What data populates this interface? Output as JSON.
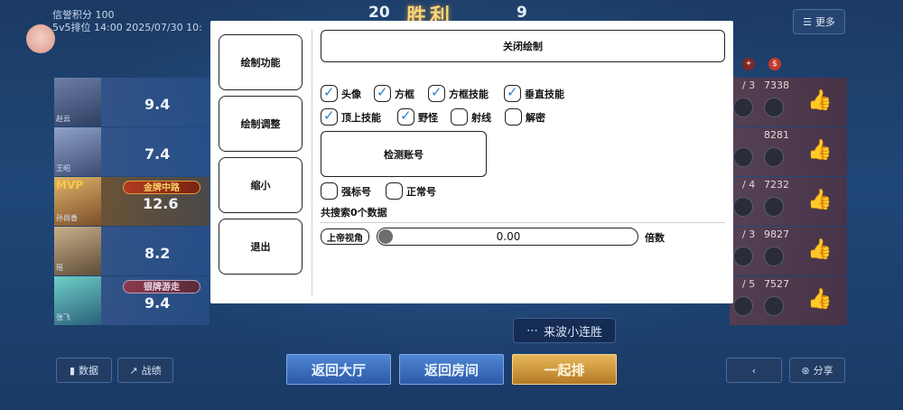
{
  "status": {
    "credit": "信誉积分 100",
    "mode_line": "5v5排位  14:00   2025/07/30 10:"
  },
  "scoreboard": {
    "left_score": "20",
    "result": "胜利",
    "right_score": "9"
  },
  "more_button": "更多",
  "left_players": [
    {
      "name": "赵云",
      "score": "9.4",
      "mvp": "",
      "medal": ""
    },
    {
      "name": "王昭",
      "score": "7.4",
      "mvp": "",
      "medal": ""
    },
    {
      "name": "孙尚香",
      "score": "12.6",
      "mvp": "MVP",
      "medal": "金牌中路"
    },
    {
      "name": "瑶",
      "score": "8.2",
      "mvp": "",
      "medal": ""
    },
    {
      "name": "张飞",
      "score": "9.4",
      "mvp": "",
      "medal": "银牌游走"
    }
  ],
  "right_players": [
    {
      "kda": "/ 3",
      "gold": "7338"
    },
    {
      "kda": "",
      "gold": "8281"
    },
    {
      "kda": "/ 4",
      "gold": "7232"
    },
    {
      "kda": "/ 3",
      "gold": "9827"
    },
    {
      "kda": "/ 5",
      "gold": "7527"
    }
  ],
  "streak": "来波小连胜",
  "bottom": {
    "data_btn": "数据",
    "battle_btn": "战绩",
    "lobby_btn": "返回大厅",
    "room_btn": "返回房间",
    "queue_btn": "一起排",
    "share_btn": "分享",
    "back_icon": "arrow-left-icon"
  },
  "dialog": {
    "side_menu": [
      "绘制功能",
      "绘制调整",
      "缩小",
      "退出"
    ],
    "close_draw": "关闭绘制",
    "options_row1": [
      {
        "label": "头像",
        "checked": true
      },
      {
        "label": "方框",
        "checked": true
      },
      {
        "label": "方框技能",
        "checked": true
      },
      {
        "label": "垂直技能",
        "checked": true
      }
    ],
    "options_row2": [
      {
        "label": "顶上技能",
        "checked": true
      },
      {
        "label": "野怪",
        "checked": true
      },
      {
        "label": "射线",
        "checked": false
      },
      {
        "label": "解密",
        "checked": false
      }
    ],
    "detect_account": "检测账号",
    "account_filters": [
      {
        "label": "强标号",
        "checked": false
      },
      {
        "label": "正常号",
        "checked": false
      }
    ],
    "search_count": "共搜索0个数据",
    "god_view": "上帝视角",
    "slider_value": "0.00",
    "slider_fraction": 0.0,
    "multiplier_label": "倍数"
  },
  "colors": {
    "check_accent": "#2f7fd0",
    "gold_button": "#e7b75a",
    "blue_button": "#4f86d4"
  }
}
